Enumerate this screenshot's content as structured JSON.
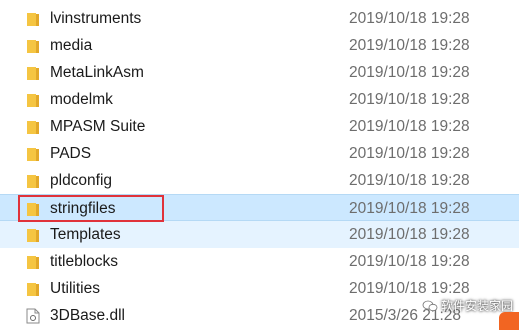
{
  "rows": [
    {
      "name": "lvinstruments",
      "date": "2019/10/18 19:28",
      "type": "folder"
    },
    {
      "name": "media",
      "date": "2019/10/18 19:28",
      "type": "folder"
    },
    {
      "name": "MetaLinkAsm",
      "date": "2019/10/18 19:28",
      "type": "folder"
    },
    {
      "name": "modelmk",
      "date": "2019/10/18 19:28",
      "type": "folder"
    },
    {
      "name": "MPASM Suite",
      "date": "2019/10/18 19:28",
      "type": "folder"
    },
    {
      "name": "PADS",
      "date": "2019/10/18 19:28",
      "type": "folder"
    },
    {
      "name": "pldconfig",
      "date": "2019/10/18 19:28",
      "type": "folder"
    },
    {
      "name": "stringfiles",
      "date": "2019/10/18 19:28",
      "type": "folder",
      "state": "selected"
    },
    {
      "name": "Templates",
      "date": "2019/10/18 19:28",
      "type": "folder",
      "state": "hover"
    },
    {
      "name": "titleblocks",
      "date": "2019/10/18 19:28",
      "type": "folder"
    },
    {
      "name": "Utilities",
      "date": "2019/10/18 19:28",
      "type": "folder"
    },
    {
      "name": "3DBase.dll",
      "date": "2015/3/26 21:28",
      "type": "file"
    }
  ],
  "watermark": {
    "text": "软件安装家园",
    "icon": "wechat-icon"
  },
  "colors": {
    "folder": "#f5c542",
    "selection": "#cce8ff",
    "hover": "#e5f3ff",
    "highlight_border": "#e0323a"
  }
}
